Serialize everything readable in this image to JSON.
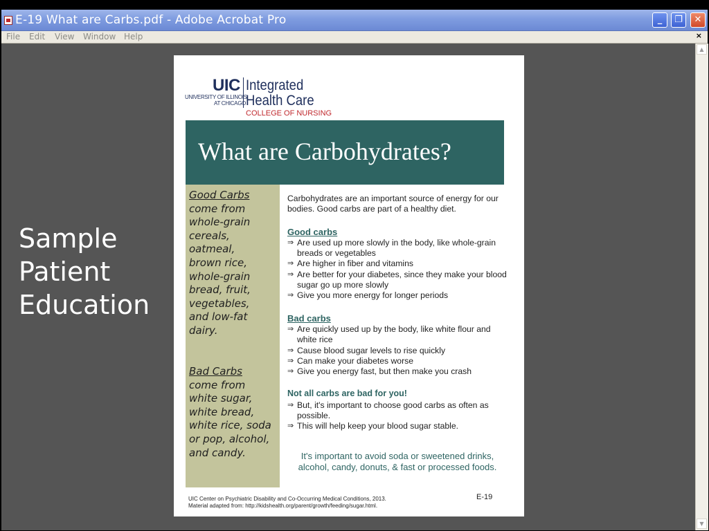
{
  "window": {
    "title": "E-19 What are Carbs.pdf - Adobe Acrobat Pro",
    "minimize_label": "_",
    "maximize_label": "❐",
    "close_label": "✕"
  },
  "menu": {
    "items": [
      "File",
      "Edit",
      "View",
      "Window",
      "Help"
    ],
    "close_doc": "×"
  },
  "slide": {
    "caption_lines": [
      "Sample",
      "Patient",
      "Education"
    ]
  },
  "document": {
    "logo": {
      "uic": "UIC",
      "univ_line1": "UNIVERSITY OF ILLINOIS",
      "univ_line2": "AT CHICAGO",
      "ihc_line1": "Integrated",
      "ihc_line2": "Health Care",
      "college": "COLLEGE OF NURSING"
    },
    "title": "What are Carbohydrates?",
    "left_column": {
      "good_head": "Good Carbs",
      "good_lines": [
        "come from",
        "whole-grain",
        "cereals,",
        "oatmeal,",
        "brown rice,",
        "whole-grain",
        "bread, fruit,",
        "vegetables,",
        "and low-fat",
        "dairy."
      ],
      "bad_head": "Bad Carbs",
      "bad_lines": [
        "come from",
        "white sugar,",
        "white bread,",
        "white rice, soda",
        "or pop, alcohol,",
        "and candy."
      ]
    },
    "intro": "Carbohydrates are an important source of energy for our bodies. Good carbs are part of a healthy diet.",
    "sections": [
      {
        "heading": "Good carbs",
        "bullets": [
          "Are used up more slowly in the body, like whole-grain breads or vegetables",
          "Are higher in fiber and vitamins",
          "Are better for your diabetes, since they make your blood sugar go up more slowly",
          "Give you more energy for longer periods"
        ]
      },
      {
        "heading": "Bad carbs",
        "bullets": [
          "Are quickly used up by the body, like white flour and white rice",
          "Cause blood sugar levels to rise quickly",
          "Can make your diabetes worse",
          "Give you energy fast, but then make you crash"
        ]
      },
      {
        "heading": "Not all carbs are bad for you!",
        "bullets": [
          "But, it's important to choose good carbs as often as possible.",
          "This will help keep your blood sugar stable."
        ]
      }
    ],
    "callout": "It's important to avoid soda or sweetened drinks, alcohol, candy, donuts, & fast or processed foods.",
    "footer_line1": "UIC Center on Psychiatric Disability and Co-Occurring Medical Conditions, 2013.",
    "footer_line2": "Material adapted from: http://kidshealth.org/parent/growth/feeding/sugar.html.",
    "code": "E-19"
  },
  "icons": {
    "bullet_arrow": "⇒",
    "scroll_up": "▲",
    "scroll_down": "▼"
  }
}
